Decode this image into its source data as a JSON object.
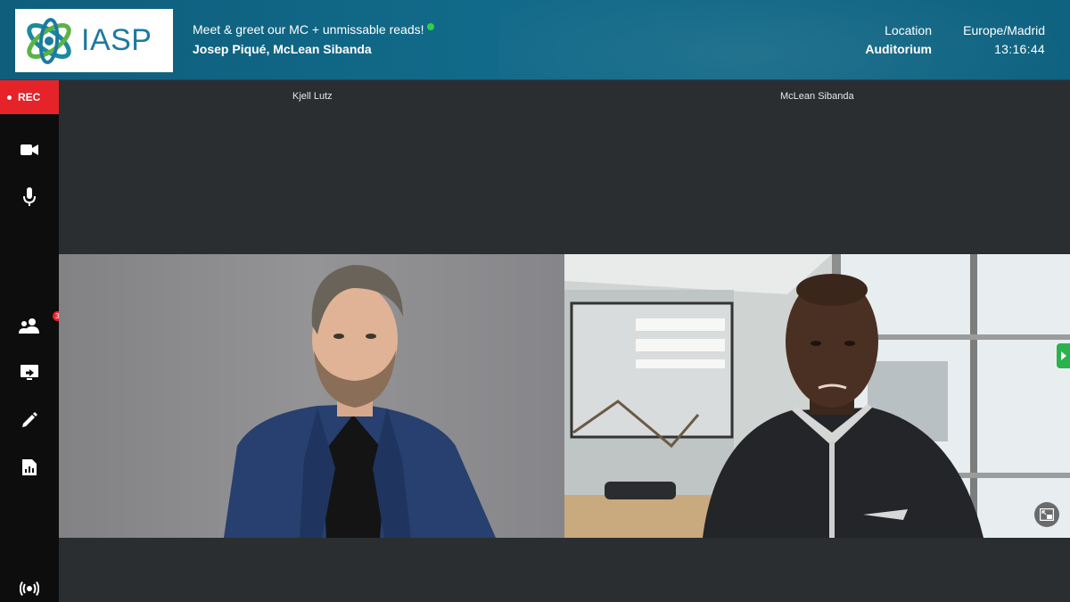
{
  "header": {
    "logo_text": "IASP",
    "event_title": "Meet & greet our MC + unmissable reads!",
    "speakers": "Josep Piqué, McLean Sibanda",
    "location_label": "Location",
    "location_value": "Auditorium",
    "timezone": "Europe/Madrid",
    "time": "13:16:44"
  },
  "sidebar": {
    "rec_label": "REC",
    "participants_count": "37",
    "icons": [
      "camera-icon",
      "microphone-icon",
      "participants-icon",
      "screen-share-icon",
      "whiteboard-icon",
      "poll-icon",
      "broadcast-icon"
    ]
  },
  "stage": {
    "participants": [
      {
        "name": "Kjell Lutz"
      },
      {
        "name": "McLean Sibanda"
      }
    ]
  },
  "colors": {
    "header_bg": "#116a89",
    "rec_red": "#e52329",
    "live_green": "#2ed14a",
    "stage_bg": "#2b2e31",
    "sidebar_bg": "#0d0d0d"
  }
}
